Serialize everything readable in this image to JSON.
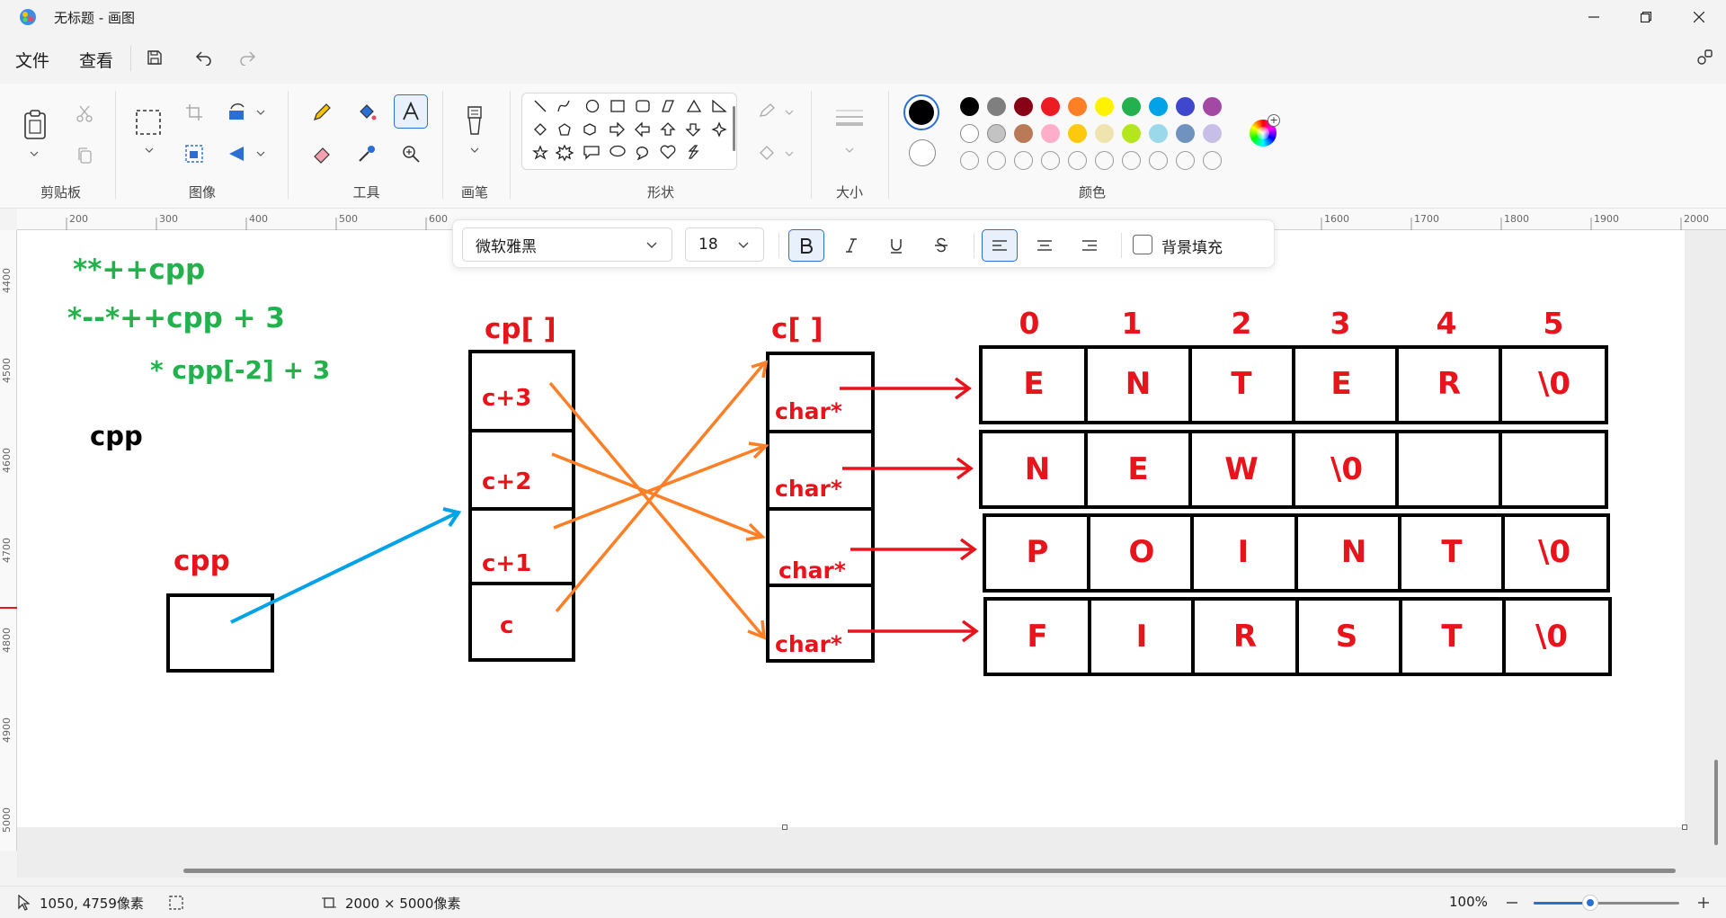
{
  "window": {
    "title": "无标题 - 画图"
  },
  "menu": {
    "file": "文件",
    "view": "查看"
  },
  "ribbon": {
    "groups": {
      "clipboard": "剪贴板",
      "image": "图像",
      "tools": "工具",
      "brush": "画笔",
      "shapes": "形状",
      "size": "大小",
      "colors": "颜色"
    }
  },
  "colors": {
    "primary": "#000000",
    "secondary": "#ffffff",
    "row1": [
      "#000000",
      "#7f7f7f",
      "#880015",
      "#ed1c24",
      "#ff7f27",
      "#fff200",
      "#22b14c",
      "#00a2e8",
      "#3f48cc",
      "#a349a4"
    ],
    "row2": [
      "#ffffff",
      "#c3c3c3",
      "#b97a57",
      "#ffaec9",
      "#ffc90e",
      "#efe4b0",
      "#b5e61d",
      "#99d9ea",
      "#7092be",
      "#c8bfe7"
    ]
  },
  "text_toolbar": {
    "font": "微软雅黑",
    "size": "18",
    "fill_label": "背景填充"
  },
  "rulers": {
    "h": [
      "200",
      "300",
      "400",
      "500",
      "600",
      "1600",
      "1700",
      "1800",
      "1900",
      "2000"
    ],
    "v": [
      "4400",
      "4500",
      "4600",
      "4700",
      "4800",
      "4900",
      "5000"
    ]
  },
  "drawing": {
    "notes": [
      "**++cpp",
      "*--*++cpp + 3",
      "* cpp[-2] + 3"
    ],
    "cpp_label_black": "cpp",
    "cpp_label": "cpp",
    "cp_label": "cp[ ]",
    "cp_cells": [
      "c+3",
      "c+2",
      "c+1",
      "c"
    ],
    "c_label": "c[ ]",
    "c_cells": [
      "char*",
      "char*",
      "char*",
      "char*"
    ],
    "indices": [
      "0",
      "1",
      "2",
      "3",
      "4",
      "5"
    ],
    "rows": [
      [
        "E",
        "N",
        "T",
        "E",
        "R",
        "\\0"
      ],
      [
        "N",
        "E",
        "W",
        "\\0",
        "",
        ""
      ],
      [
        "P",
        "O",
        "I",
        "N",
        "T",
        "\\0"
      ],
      [
        "F",
        "I",
        "R",
        "S",
        "T",
        "\\0"
      ]
    ]
  },
  "status": {
    "cursor": "1050, 4759像素",
    "canvas_size": "2000 × 5000像素",
    "zoom": "100%"
  }
}
